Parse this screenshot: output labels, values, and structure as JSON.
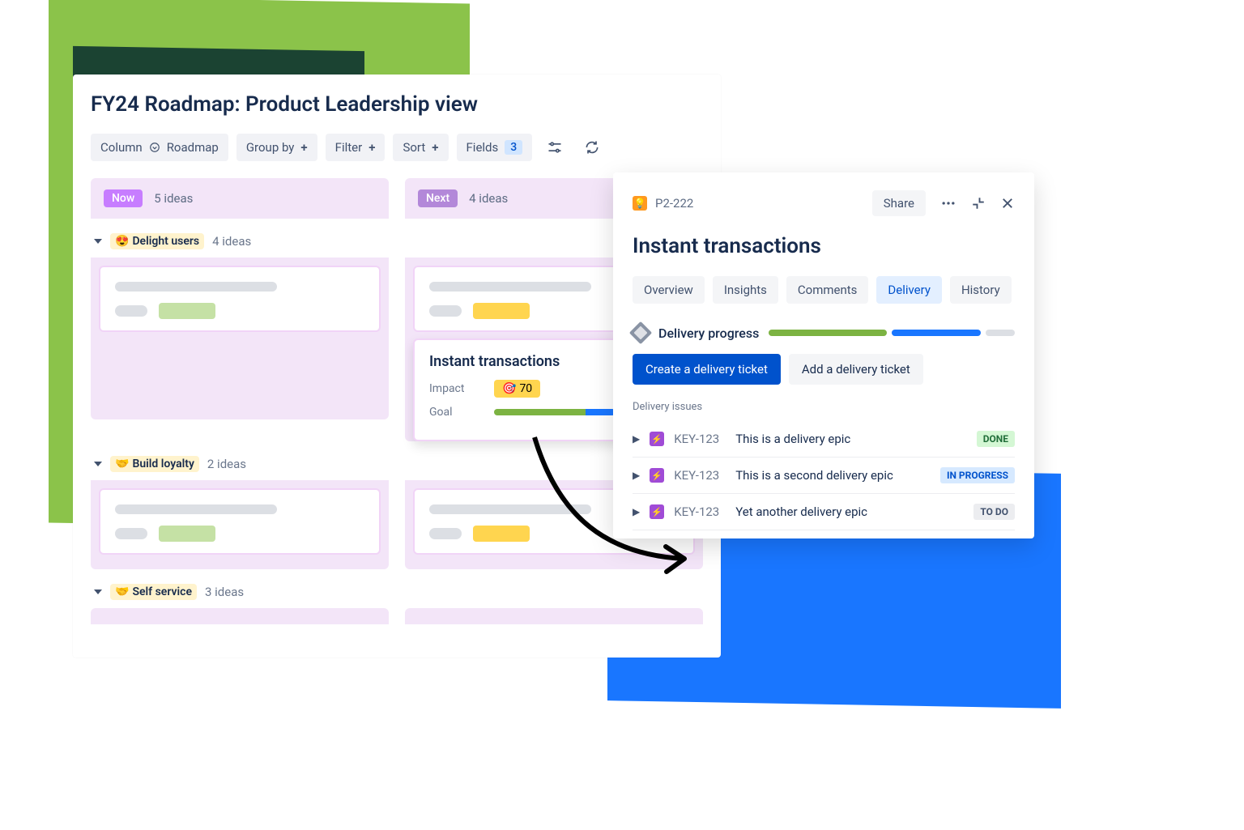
{
  "board": {
    "title": "FY24 Roadmap: Product Leadership view",
    "toolbar": {
      "column_label": "Column",
      "column_value": "Roadmap",
      "group_by": "Group by",
      "filter": "Filter",
      "sort": "Sort",
      "fields": "Fields",
      "fields_count": "3"
    },
    "columns": [
      {
        "name": "Now",
        "count": "5 ideas"
      },
      {
        "name": "Next",
        "count": "4 ideas"
      }
    ],
    "groups": [
      {
        "emoji": "😍",
        "name": "Delight users",
        "count": "4 ideas"
      },
      {
        "emoji": "🤝",
        "name": "Build loyalty",
        "count": "2 ideas"
      },
      {
        "emoji": "🤝",
        "name": "Self service",
        "count": "3 ideas"
      }
    ],
    "focus_card": {
      "title": "Instant transactions",
      "impact_label": "Impact",
      "impact_value": "70",
      "goal_label": "Goal"
    }
  },
  "panel": {
    "issue_key": "P2-222",
    "share": "Share",
    "title": "Instant transactions",
    "tabs": {
      "overview": "Overview",
      "insights": "Insights",
      "comments": "Comments",
      "delivery": "Delivery",
      "history": "History"
    },
    "delivery_progress_label": "Delivery progress",
    "progress_segments": [
      {
        "color": "#7cb342",
        "flex": 4
      },
      {
        "color": "#1976ff",
        "flex": 3
      },
      {
        "color": "#dcdfe4",
        "flex": 1
      }
    ],
    "create_btn": "Create a delivery ticket",
    "add_btn": "Add a delivery ticket",
    "delivery_issues_label": "Delivery issues",
    "issues": [
      {
        "key": "KEY-123",
        "summary": "This is a delivery epic",
        "status": "DONE",
        "status_class": "done"
      },
      {
        "key": "KEY-123",
        "summary": "This is a second delivery epic",
        "status": "IN PROGRESS",
        "status_class": "inprog"
      },
      {
        "key": "KEY-123",
        "summary": "Yet another delivery epic",
        "status": "TO DO",
        "status_class": "todo"
      }
    ]
  }
}
